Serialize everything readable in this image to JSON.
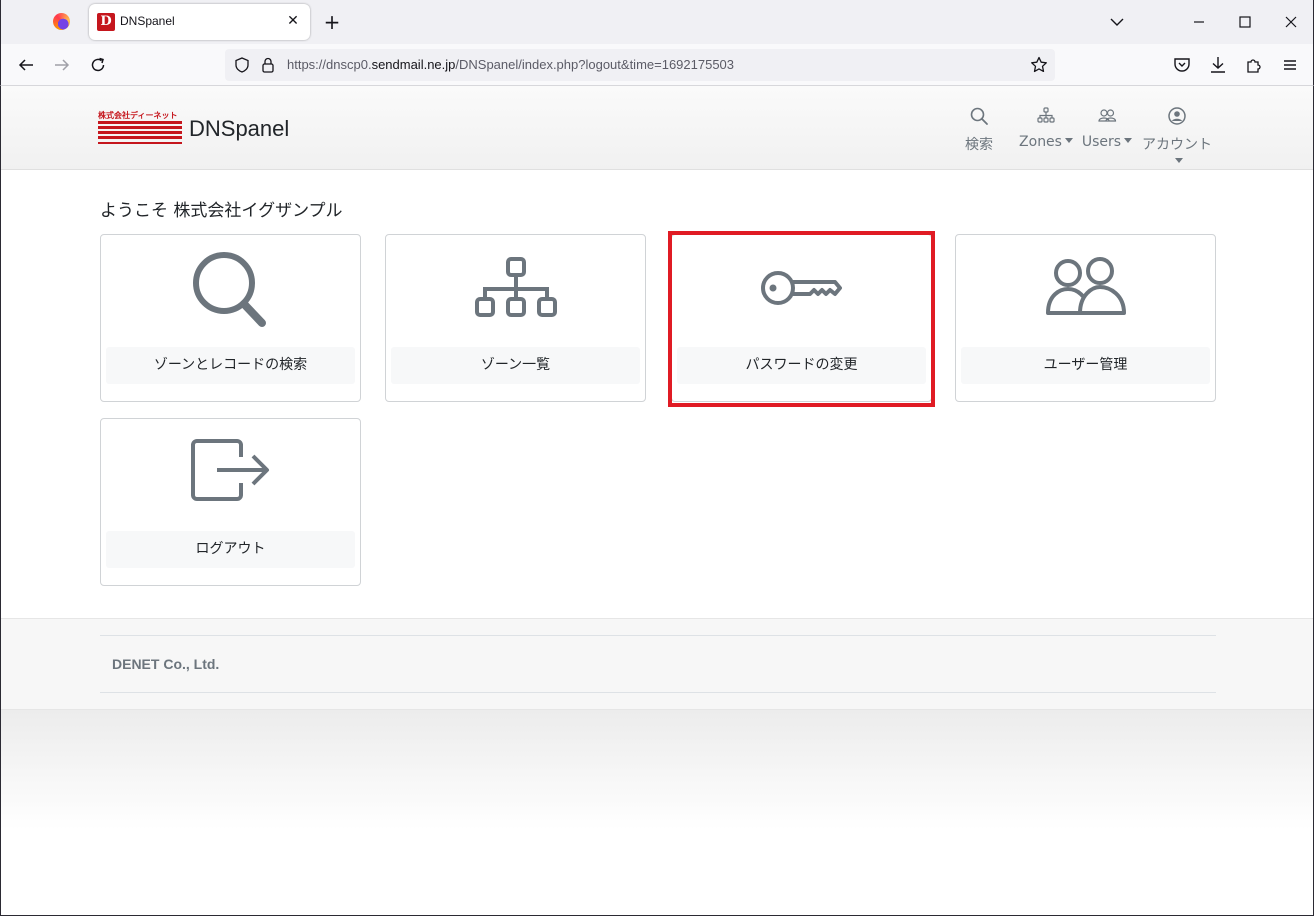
{
  "browser": {
    "tab_title": "DNSpanel",
    "tab_favicon_letter": "D",
    "new_tab": "+",
    "tab_close": "✕",
    "url_prefix": "https://dnscp0.",
    "url_domain": "sendmail.ne.jp",
    "url_path": "/DNSpanel/index.php?logout&time=1692175503"
  },
  "header": {
    "brand": "DNSpanel",
    "logo_text": "株式会社ディーネット",
    "nav": [
      {
        "label": "検索",
        "icon": "search-icon",
        "dropdown": false
      },
      {
        "label": "Zones",
        "icon": "sitemap-icon",
        "dropdown": true
      },
      {
        "label": "Users",
        "icon": "users-icon",
        "dropdown": true
      },
      {
        "label": "アカウント",
        "icon": "account-icon",
        "dropdown": true
      }
    ]
  },
  "main": {
    "welcome": "ようこそ 株式会社イグザンプル",
    "cards": [
      {
        "label": "ゾーンとレコードの検索",
        "icon": "search-icon"
      },
      {
        "label": "ゾーン一覧",
        "icon": "sitemap-icon"
      },
      {
        "label": "パスワードの変更",
        "icon": "key-icon",
        "highlighted": true
      },
      {
        "label": "ユーザー管理",
        "icon": "users-icon"
      },
      {
        "label": "ログアウト",
        "icon": "logout-icon"
      }
    ]
  },
  "footer": {
    "text": "DENET Co., Ltd."
  },
  "colors": {
    "accent": "#c5161d",
    "icon_gray": "#6c757d",
    "highlight": "#e01b24"
  }
}
